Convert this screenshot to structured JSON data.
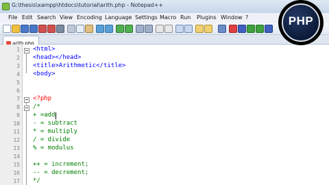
{
  "window": {
    "title": "G:\\thesis\\xampp\\htdocs\\tutorial\\arith.php - Notepad++"
  },
  "menu": [
    "File",
    "Edit",
    "Search",
    "View",
    "Encoding",
    "Language",
    "Settings",
    "Macro",
    "Run",
    "Plugins",
    "Window",
    "?"
  ],
  "tab": {
    "label": "arith.php"
  },
  "logo": {
    "text": "PHP"
  },
  "editor": {
    "lines": [
      {
        "n": "1",
        "text": "<html>"
      },
      {
        "n": "2",
        "text": "<head></head>"
      },
      {
        "n": "3",
        "text": "<title>Arithmetic</title>"
      },
      {
        "n": "4",
        "text": "<body>"
      },
      {
        "n": "5",
        "text": ""
      },
      {
        "n": "6",
        "text": ""
      },
      {
        "n": "7",
        "text": "<?php"
      },
      {
        "n": "8",
        "text": "/*"
      },
      {
        "n": "9",
        "text": "+ =add"
      },
      {
        "n": "10",
        "text": "- = subtract"
      },
      {
        "n": "11",
        "text": "* = multiply"
      },
      {
        "n": "12",
        "text": "/ = divide"
      },
      {
        "n": "13",
        "text": "% = modulus"
      },
      {
        "n": "14",
        "text": ""
      },
      {
        "n": "15",
        "text": "++ = increment;"
      },
      {
        "n": "16",
        "text": "-- = decrement;"
      },
      {
        "n": "17",
        "text": "*/"
      }
    ]
  }
}
